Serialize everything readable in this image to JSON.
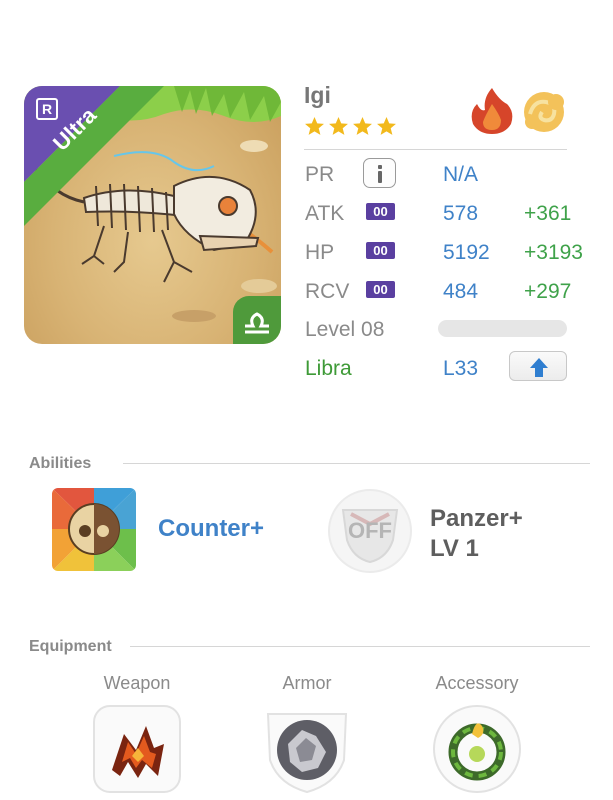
{
  "monster": {
    "name": "Igi",
    "rarity_letter": "R",
    "rarity_ribbon": "Ultra",
    "stars": 4,
    "elements": [
      "fire-icon",
      "wind-icon"
    ]
  },
  "stats": {
    "pr": {
      "label": "PR",
      "value": "N/A"
    },
    "atk": {
      "label": "ATK",
      "plus": "00",
      "value": "578",
      "bonus": "+361"
    },
    "hp": {
      "label": "HP",
      "plus": "00",
      "value": "5192",
      "bonus": "+3193"
    },
    "rcv": {
      "label": "RCV",
      "plus": "00",
      "value": "484",
      "bonus": "+297"
    },
    "level": {
      "label": "Level 08",
      "progress": 0.0
    },
    "zodiac": {
      "label": "Libra",
      "value": "L33"
    }
  },
  "abilities": {
    "title": "Abilities",
    "primary": {
      "name": "Counter+"
    },
    "secondary": {
      "badge": "OFF",
      "name_line1": "Panzer+",
      "name_line2": "LV 1"
    }
  },
  "equipment": {
    "title": "Equipment",
    "slots": [
      {
        "label": "Weapon",
        "icon": "weapon-icon"
      },
      {
        "label": "Armor",
        "icon": "armor-icon"
      },
      {
        "label": "Accessory",
        "icon": "accessory-icon"
      }
    ]
  },
  "colors": {
    "accent_blue": "#3f82c8",
    "bonus_green": "#3fa24a",
    "plus_purple": "#5a3fa0",
    "ribbon_green": "#59ad3f"
  }
}
